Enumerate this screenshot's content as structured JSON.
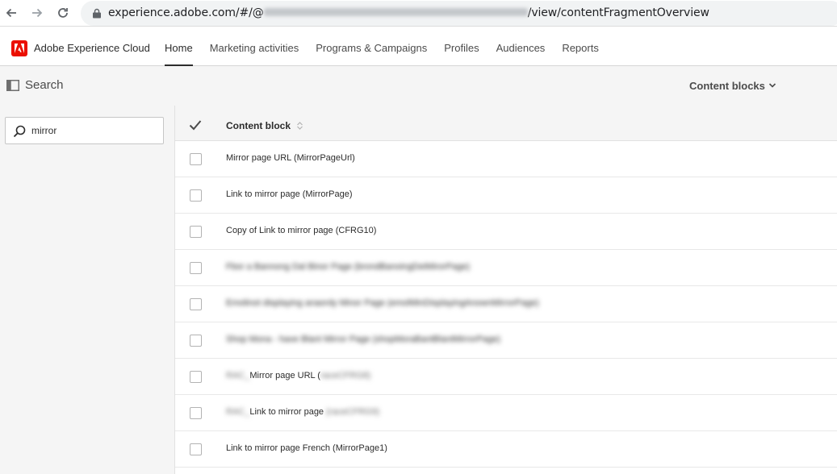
{
  "browser": {
    "url_prefix": "experience.adobe.com/#/@",
    "url_suffix": "/view/contentFragmentOverview"
  },
  "header": {
    "brand": "Adobe Experience Cloud",
    "tabs": [
      {
        "label": "Home",
        "active": true
      },
      {
        "label": "Marketing activities",
        "active": false
      },
      {
        "label": "Programs & Campaigns",
        "active": false
      },
      {
        "label": "Profiles",
        "active": false
      },
      {
        "label": "Audiences",
        "active": false
      },
      {
        "label": "Reports",
        "active": false
      }
    ]
  },
  "toolbar": {
    "title": "Search",
    "dropdown_label": "Content blocks"
  },
  "search": {
    "value": "mirror"
  },
  "table": {
    "column_header": "Content block",
    "rows": [
      {
        "label": "Mirror page URL (MirrorPageUrl)"
      },
      {
        "label": "Link to mirror page (MirrorPage)"
      },
      {
        "label": "Copy of Link to mirror page (CFRG10)"
      },
      {
        "label": "Fbor a Bannong Dal Binor Page (brondBanoingDeiMirorPage)"
      },
      {
        "label": "Emolinot displaying anaordy Minor Page (emolMinDisplayingAnownMirrorPage)"
      },
      {
        "label": "Shop Mona - have Blant Mirror Page (shopMoraBantBlantMirrorPage)"
      },
      {
        "label_prefix": "RAC_",
        "label_visible": "Mirror page URL (",
        "label_blurred": "raceCFRG8)"
      },
      {
        "label_prefix": "RAC_",
        "label_visible": "Link to mirror page",
        "label_blurred": " (raceCFRG9)"
      },
      {
        "label": "Link to mirror page French (MirrorPage1)"
      }
    ]
  },
  "colors": {
    "adobe_red": "#eb1000",
    "toolbar_bg": "#f5f5f5",
    "text": "#2c2c2c"
  }
}
